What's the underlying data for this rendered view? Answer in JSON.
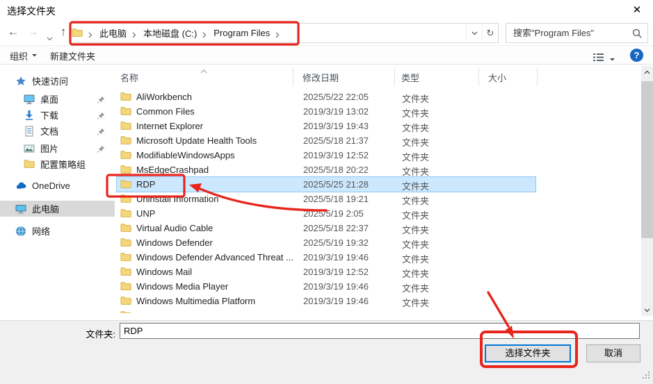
{
  "window": {
    "title": "选择文件夹",
    "close_icon": "✕"
  },
  "nav": {
    "back_icon": "←",
    "forward_icon": "→",
    "up_icon": "↑",
    "breadcrumb": {
      "items": [
        "此电脑",
        "本地磁盘 (C:)",
        "Program Files"
      ]
    },
    "refresh_icon": "↻",
    "search": {
      "placeholder": "搜索\"Program Files\""
    }
  },
  "toolbar": {
    "organize_label": "组织",
    "new_folder_label": "新建文件夹"
  },
  "sidebar": {
    "items": [
      {
        "label": "快速访问",
        "icon": "quick-access-star-icon",
        "pinned": false,
        "selected": false
      },
      {
        "label": "桌面",
        "icon": "desktop-icon",
        "pinned": true,
        "selected": false
      },
      {
        "label": "下载",
        "icon": "downloads-icon",
        "pinned": true,
        "selected": false
      },
      {
        "label": "文档",
        "icon": "documents-icon",
        "pinned": true,
        "selected": false
      },
      {
        "label": "图片",
        "icon": "pictures-icon",
        "pinned": true,
        "selected": false
      },
      {
        "label": "配置策略组",
        "icon": "folder-icon",
        "pinned": false,
        "selected": false
      },
      {
        "label": "OneDrive",
        "icon": "onedrive-cloud-icon",
        "pinned": false,
        "selected": false
      },
      {
        "label": "此电脑",
        "icon": "this-pc-icon",
        "pinned": false,
        "selected": true
      },
      {
        "label": "网络",
        "icon": "network-icon",
        "pinned": false,
        "selected": false
      }
    ]
  },
  "list": {
    "columns": {
      "name": "名称",
      "date": "修改日期",
      "type": "类型",
      "size": "大小"
    },
    "rows": [
      {
        "name": "AliWorkbench",
        "date": "2025/5/22 22:05",
        "type": "文件夹",
        "size": "",
        "selected": false
      },
      {
        "name": "Common Files",
        "date": "2019/3/19 13:02",
        "type": "文件夹",
        "size": "",
        "selected": false
      },
      {
        "name": "Internet Explorer",
        "date": "2019/3/19 19:43",
        "type": "文件夹",
        "size": "",
        "selected": false
      },
      {
        "name": "Microsoft Update Health Tools",
        "date": "2025/5/18 21:37",
        "type": "文件夹",
        "size": "",
        "selected": false
      },
      {
        "name": "ModifiableWindowsApps",
        "date": "2019/3/19 12:52",
        "type": "文件夹",
        "size": "",
        "selected": false
      },
      {
        "name": "MsEdgeCrashpad",
        "date": "2025/5/18 20:22",
        "type": "文件夹",
        "size": "",
        "selected": false
      },
      {
        "name": "RDP",
        "date": "2025/5/25 21:28",
        "type": "文件夹",
        "size": "",
        "selected": true
      },
      {
        "name": "Uninstall Information",
        "date": "2025/5/18 19:21",
        "type": "文件夹",
        "size": "",
        "selected": false
      },
      {
        "name": "UNP",
        "date": "2025/5/19 2:05",
        "type": "文件夹",
        "size": "",
        "selected": false
      },
      {
        "name": "Virtual Audio Cable",
        "date": "2025/5/18 22:37",
        "type": "文件夹",
        "size": "",
        "selected": false
      },
      {
        "name": "Windows Defender",
        "date": "2025/5/19 19:32",
        "type": "文件夹",
        "size": "",
        "selected": false
      },
      {
        "name": "Windows Defender Advanced Threat ...",
        "date": "2019/3/19 19:46",
        "type": "文件夹",
        "size": "",
        "selected": false
      },
      {
        "name": "Windows Mail",
        "date": "2019/3/19 12:52",
        "type": "文件夹",
        "size": "",
        "selected": false
      },
      {
        "name": "Windows Media Player",
        "date": "2019/3/19 19:46",
        "type": "文件夹",
        "size": "",
        "selected": false
      },
      {
        "name": "Windows Multimedia Platform",
        "date": "2019/3/19 19:46",
        "type": "文件夹",
        "size": "",
        "selected": false
      },
      {
        "name": "",
        "date": "",
        "type": "",
        "size": "",
        "selected": false
      }
    ]
  },
  "footer": {
    "folder_label": "文件夹:",
    "folder_value": "RDP",
    "select_button_label": "选择文件夹",
    "cancel_button_label": "取消"
  },
  "annotations": {
    "highlight_color": "#e8251c",
    "selected_row_color": "#cce8ff"
  }
}
